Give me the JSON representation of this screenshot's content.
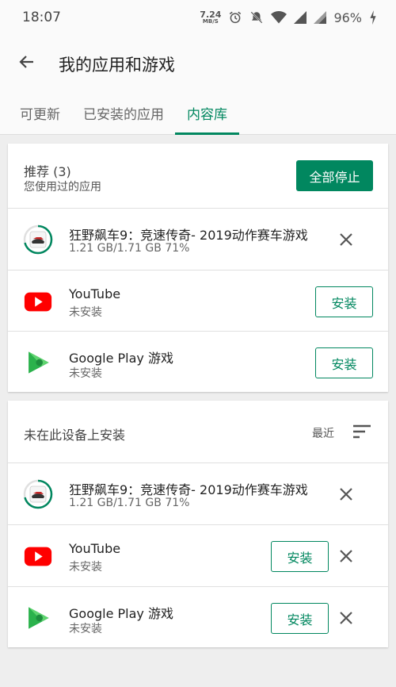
{
  "status_bar": {
    "time": "18:07",
    "net_speed_value": "7.24",
    "net_speed_unit": "MB/S",
    "battery": "96%",
    "icons": [
      "alarm-icon",
      "mute-icon",
      "wifi-icon",
      "signal-icon",
      "signal-icon",
      "battery-charging-icon"
    ]
  },
  "app_bar": {
    "title": "我的应用和游戏"
  },
  "tabs": [
    {
      "label": "可更新",
      "active": false
    },
    {
      "label": "已安装的应用",
      "active": false
    },
    {
      "label": "内容库",
      "active": true
    }
  ],
  "recommended": {
    "title": "推荐 (3)",
    "subtitle": "您使用过的应用",
    "stop_all_label": "全部停止",
    "items": [
      {
        "name": "狂野飙车9：竞速传奇- 2019动作赛车游戏",
        "sub": "1.21 GB/1.71 GB  71%",
        "progress": 0.71,
        "icon": "asphalt-game-icon",
        "action": "cancel"
      },
      {
        "name": "YouTube",
        "sub": "未安装",
        "icon": "youtube-icon",
        "action_label": "安装"
      },
      {
        "name": "Google Play 游戏",
        "sub": "未安装",
        "icon": "play-games-icon",
        "action_label": "安装"
      }
    ]
  },
  "not_installed": {
    "title": "未在此设备上安装",
    "sort_label": "最近",
    "items": [
      {
        "name": "狂野飙车9：竞速传奇- 2019动作赛车游戏",
        "sub": "1.21 GB/1.71 GB  71%",
        "progress": 0.71,
        "icon": "asphalt-game-icon",
        "action": "cancel"
      },
      {
        "name": "YouTube",
        "sub": "未安装",
        "icon": "youtube-icon",
        "action_label": "安装"
      },
      {
        "name": "Google Play 游戏",
        "sub": "未安装",
        "icon": "play-games-icon",
        "action_label": "安装"
      }
    ]
  },
  "colors": {
    "accent": "#01875f",
    "youtube_red": "#ff0000",
    "play_green": "#2bb24c"
  }
}
